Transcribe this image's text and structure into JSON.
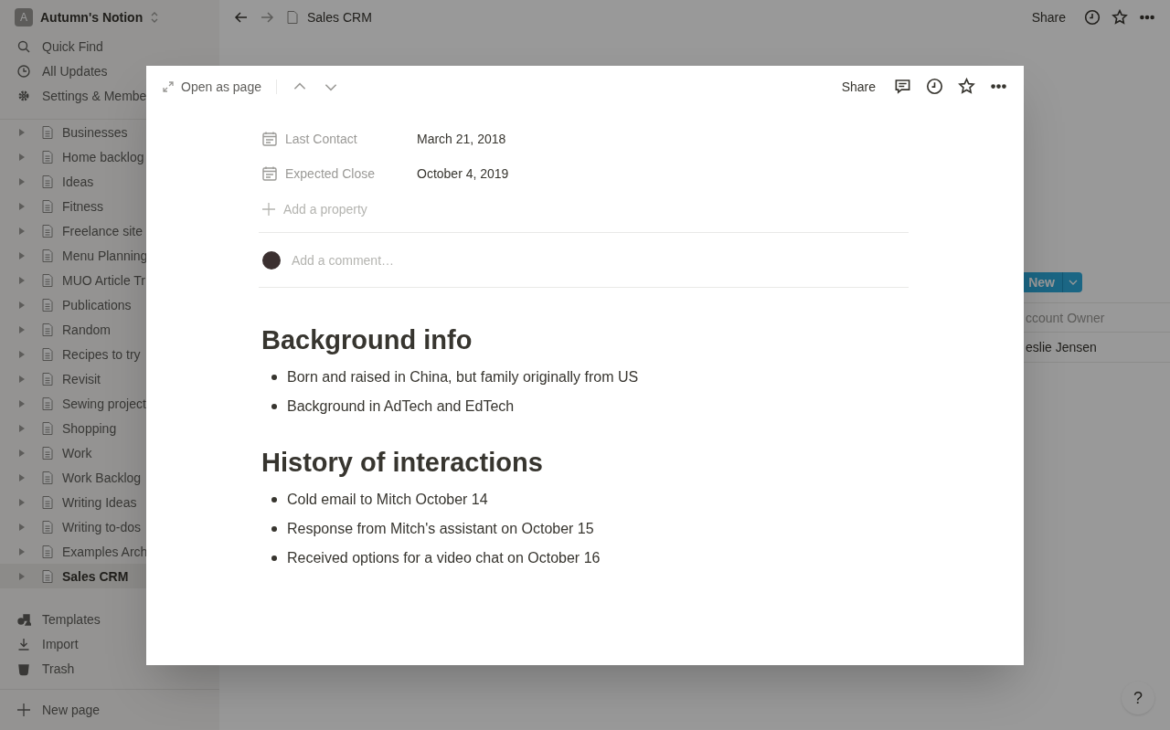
{
  "workspace": {
    "initial": "A",
    "name": "Autumn's Notion"
  },
  "sidebar": {
    "nav": [
      {
        "kind": "search",
        "label": "Quick Find"
      },
      {
        "kind": "updates",
        "label": "All Updates"
      },
      {
        "kind": "settings",
        "label": "Settings & Membe"
      }
    ],
    "pages": [
      {
        "label": "Businesses",
        "selected": false
      },
      {
        "label": "Home backlog",
        "selected": false
      },
      {
        "label": "Ideas",
        "selected": false
      },
      {
        "label": "Fitness",
        "selected": false
      },
      {
        "label": "Freelance site",
        "selected": false
      },
      {
        "label": "Menu Planning",
        "selected": false
      },
      {
        "label": "MUO Article Tr",
        "selected": false
      },
      {
        "label": "Publications",
        "selected": false
      },
      {
        "label": "Random",
        "selected": false
      },
      {
        "label": "Recipes to try",
        "selected": false
      },
      {
        "label": "Revisit",
        "selected": false
      },
      {
        "label": "Sewing project",
        "selected": false
      },
      {
        "label": "Shopping",
        "selected": false
      },
      {
        "label": "Work",
        "selected": false
      },
      {
        "label": "Work Backlog",
        "selected": false
      },
      {
        "label": "Writing Ideas",
        "selected": false
      },
      {
        "label": "Writing to-dos",
        "selected": false
      },
      {
        "label": "Examples Arch",
        "selected": false
      },
      {
        "label": "Sales CRM",
        "selected": true
      }
    ],
    "footer": [
      {
        "kind": "templates",
        "label": "Templates"
      },
      {
        "kind": "import",
        "label": "Import"
      },
      {
        "kind": "trash",
        "label": "Trash"
      }
    ],
    "new_page": "New page"
  },
  "topbar": {
    "breadcrumb": "Sales CRM",
    "share": "Share"
  },
  "database": {
    "new_button": "New",
    "column": "ccount Owner",
    "cell": "eslie Jensen"
  },
  "help": "?",
  "modal": {
    "open_as_page": "Open as page",
    "share": "Share",
    "properties": [
      {
        "label": "Last Contact",
        "value": "March 21, 2018"
      },
      {
        "label": "Expected Close",
        "value": "October 4, 2019"
      }
    ],
    "add_property": "Add a property",
    "comment_placeholder": "Add a comment…",
    "sections": [
      {
        "heading": "Background info",
        "bullets": [
          "Born and raised in China, but family originally from US",
          "Background in AdTech and EdTech"
        ]
      },
      {
        "heading": "History of interactions",
        "bullets": [
          "Cold email to Mitch October 14",
          "Response from Mitch's assistant on October 15",
          "Received options for a video chat on October 16"
        ]
      }
    ]
  }
}
